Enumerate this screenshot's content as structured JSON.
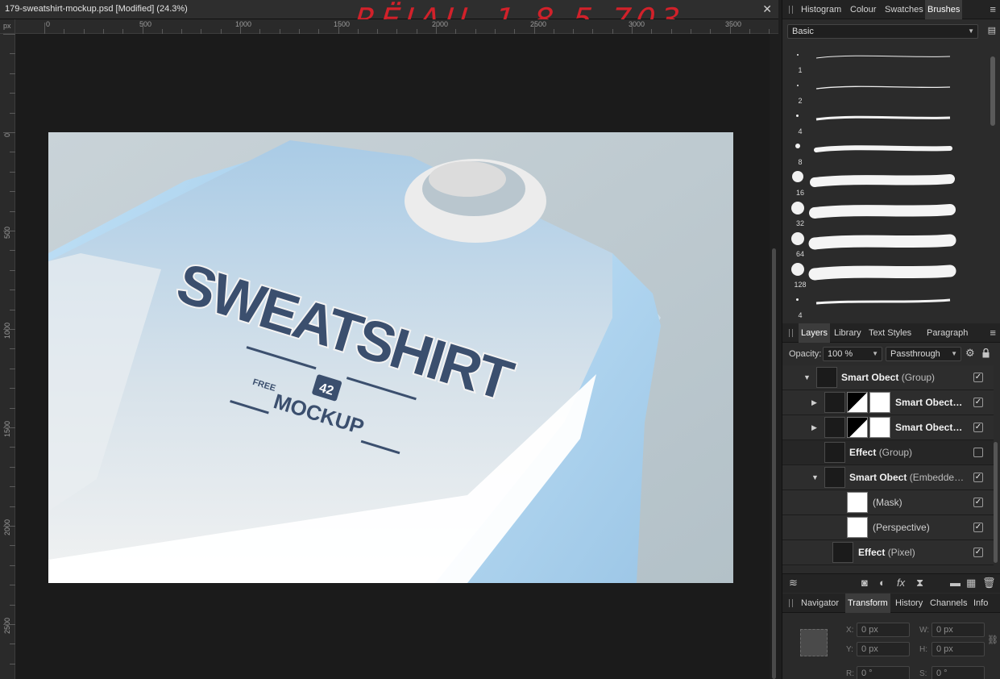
{
  "document": {
    "title": "179-sweatshirt-mockup.psd [Modified] (24.3%)",
    "close_glyph": "✕",
    "watermark": "RЁIAIL 1.8.5.703",
    "ruler_unit": "px",
    "ruler_top_labels": [
      "0",
      "500",
      "1000",
      "1500",
      "2000",
      "2500",
      "3000",
      "3500"
    ],
    "ruler_left_labels": [
      "0",
      "500",
      "1000",
      "1500",
      "2000",
      "2500"
    ],
    "artwork": {
      "headline": "SWEATSHIRT",
      "number": "42",
      "badge": "FREE",
      "subline": "MOCKUP"
    }
  },
  "brushes_panel": {
    "tabs": [
      "Histogram",
      "Colour",
      "Swatches",
      "Brushes"
    ],
    "active_tab": "Brushes",
    "category": "Basic",
    "brush_sizes": [
      "1",
      "2",
      "4",
      "8",
      "16",
      "32",
      "64",
      "128",
      "4"
    ]
  },
  "layers_panel": {
    "tabs": [
      "Layers",
      "Library",
      "Text Styles",
      "Paragraph"
    ],
    "active_tab": "Layers",
    "opacity_label": "Opacity:",
    "opacity_value": "100 %",
    "blend_mode": "Passthrough",
    "rows": [
      {
        "name": "Smart Obect",
        "type": "(Group)",
        "checked": true
      },
      {
        "name": "Smart Obect…",
        "type": "",
        "checked": true
      },
      {
        "name": "Smart Obect…",
        "type": "",
        "checked": true
      },
      {
        "name": "Effect",
        "type": "(Group)",
        "checked": false
      },
      {
        "name": "Smart Obect",
        "type": "(Embedde…",
        "checked": true
      },
      {
        "name": "(Mask)",
        "type": "",
        "checked": true
      },
      {
        "name": "(Perspective)",
        "type": "",
        "checked": true
      },
      {
        "name": "Effect",
        "type": "(Pixel)",
        "checked": true
      }
    ]
  },
  "transform_panel": {
    "tabs": [
      "Navigator",
      "Transform",
      "History",
      "Channels",
      "Info"
    ],
    "active_tab": "Transform",
    "x_label": "X:",
    "x_value": "0 px",
    "y_label": "Y:",
    "y_value": "0 px",
    "w_label": "W:",
    "w_value": "0 px",
    "h_label": "H:",
    "h_value": "0 px",
    "r_label": "R:",
    "r_value": "0 °",
    "s_label": "S:",
    "s_value": "0 °"
  },
  "colors": {
    "sweatshirt_blue": "#a9cbe6",
    "sweatshirt_light": "#eef0f0",
    "print_navy": "#3b4f6e",
    "watermark_red": "#e0202a"
  }
}
